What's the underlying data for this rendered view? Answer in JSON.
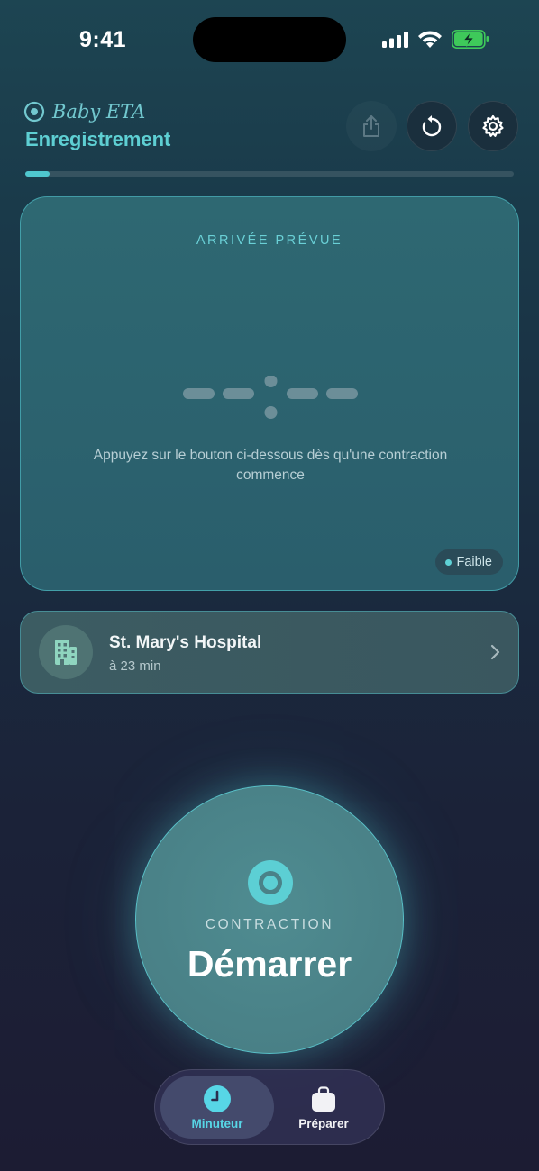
{
  "status_bar": {
    "time": "9:41",
    "icons": [
      "cellular-signal-icon",
      "wifi-icon",
      "battery-charging-icon"
    ],
    "battery_color": "#3ec95a"
  },
  "header": {
    "brand_icon": "record-circle-icon",
    "brand_name": "Baby ETA",
    "title": "Enregistrement",
    "actions": [
      {
        "icon": "share-icon"
      },
      {
        "icon": "reset-icon"
      },
      {
        "icon": "gear-icon"
      }
    ],
    "progress_fraction": 0.05
  },
  "eta_card": {
    "label": "ARRIVÉE PRÉVUE",
    "placeholder_icon": "empty-time-placeholder-icon",
    "hint": "Appuyez sur le bouton ci-dessous dès qu'une contraction commence",
    "confidence": "Faible"
  },
  "hospital": {
    "icon": "hospital-building-icon",
    "name": "St. Mary's Hospital",
    "eta": "à 23 min",
    "chevron_icon": "chevron-right-icon"
  },
  "contraction_button": {
    "icon": "record-circle-icon",
    "label": "CONTRACTION",
    "action": "Démarrer"
  },
  "tabbar": {
    "tabs": [
      {
        "label": "Minuteur",
        "icon": "clock-icon",
        "active": true
      },
      {
        "label": "Préparer",
        "icon": "bag-icon",
        "active": false
      }
    ]
  },
  "colors": {
    "accent": "#5ecfd3",
    "tab_active": "#57d6e6"
  }
}
